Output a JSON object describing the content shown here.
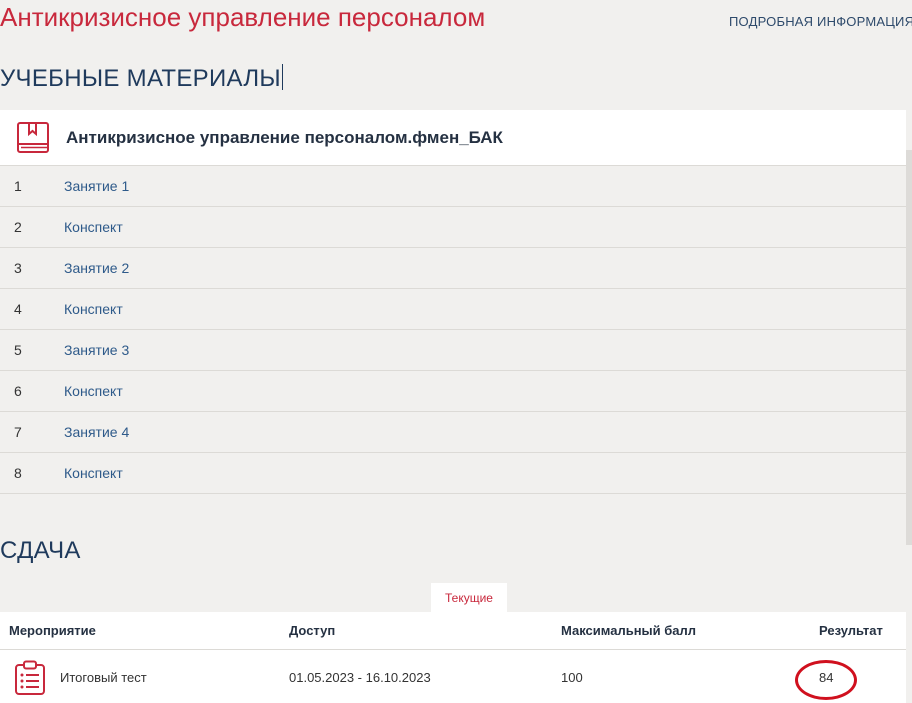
{
  "header": {
    "course_title": "Антикризисное управление персоналом",
    "more_info_link": "ПОДРОБНАЯ ИНФОРМАЦИЯ"
  },
  "materials": {
    "section_title": "УЧЕБНЫЕ МАТЕРИАЛЫ",
    "module_title": "Антикризисное управление персоналом.фмен_БАК",
    "module_icon": "book-icon",
    "items": [
      {
        "num": "1",
        "label": "Занятие 1"
      },
      {
        "num": "2",
        "label": "Конспект"
      },
      {
        "num": "3",
        "label": "Занятие 2"
      },
      {
        "num": "4",
        "label": "Конспект"
      },
      {
        "num": "5",
        "label": "Занятие 3"
      },
      {
        "num": "6",
        "label": "Конспект"
      },
      {
        "num": "7",
        "label": "Занятие 4"
      },
      {
        "num": "8",
        "label": "Конспект"
      }
    ]
  },
  "submission": {
    "section_title": "СДАЧА",
    "tab_current": "Текущие",
    "columns": {
      "event": "Мероприятие",
      "access": "Доступ",
      "max_score": "Максимальный балл",
      "result": "Результат"
    },
    "rows": [
      {
        "icon": "clipboard-list-icon",
        "event": "Итоговый тест",
        "access": "01.05.2023 - 16.10.2023",
        "max_score": "100",
        "result": "84"
      }
    ]
  },
  "colors": {
    "accent_red": "#c8283c",
    "navy": "#1f3a5c",
    "link_blue": "#2e5a8a",
    "background": "#f1f0ee",
    "annotation_circle": "#d0101e"
  }
}
